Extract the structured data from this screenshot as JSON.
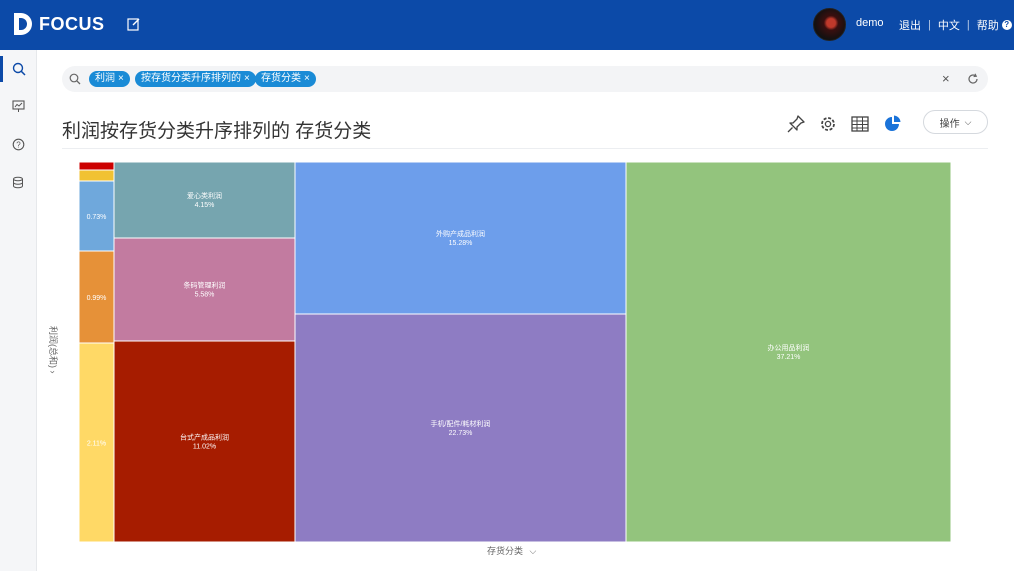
{
  "app": {
    "name": "FOCUS"
  },
  "header": {
    "username": "demo",
    "logout": "退出",
    "language": "中文",
    "help": "帮助"
  },
  "search": {
    "chips": [
      "利润",
      "按存货分类升序排列的",
      "存货分类"
    ]
  },
  "page": {
    "title": "利润按存货分类升序排列的 存货分类",
    "op_button": "操作"
  },
  "icons": {
    "pin": "pin-icon",
    "settings": "gear-icon",
    "table": "table-icon",
    "chart": "pie-chart-icon"
  },
  "chart_data": {
    "type": "treemap",
    "xlabel": "存货分类",
    "ylabel": "利润(总和)",
    "items": [
      {
        "label": "办公用品利润",
        "share": "37.21%",
        "color": "#93c47d"
      },
      {
        "label": "手机/配件/耗材利润",
        "share": "22.73%",
        "color": "#8e7cc3"
      },
      {
        "label": "外购产成品利润",
        "share": "15.28%",
        "color": "#6d9eeb"
      },
      {
        "label": "台式产成品利润",
        "share": "11.02%",
        "color": "#a61c00"
      },
      {
        "label": "条码管理利润",
        "share": "5.58%",
        "color": "#c27ba0"
      },
      {
        "label": "爱心类利润",
        "share": "4.15%",
        "color": "#76a5af"
      },
      {
        "label": "",
        "share": "2.11%",
        "color": "#ffd966"
      },
      {
        "label": "",
        "share": "0.99%",
        "color": "#e69138"
      },
      {
        "label": "",
        "share": "0.73%",
        "color": "#6fa8dc"
      },
      {
        "label": "",
        "share": "",
        "color": "#f1c232"
      },
      {
        "label": "",
        "share": "",
        "color": "#cc0000"
      }
    ]
  }
}
